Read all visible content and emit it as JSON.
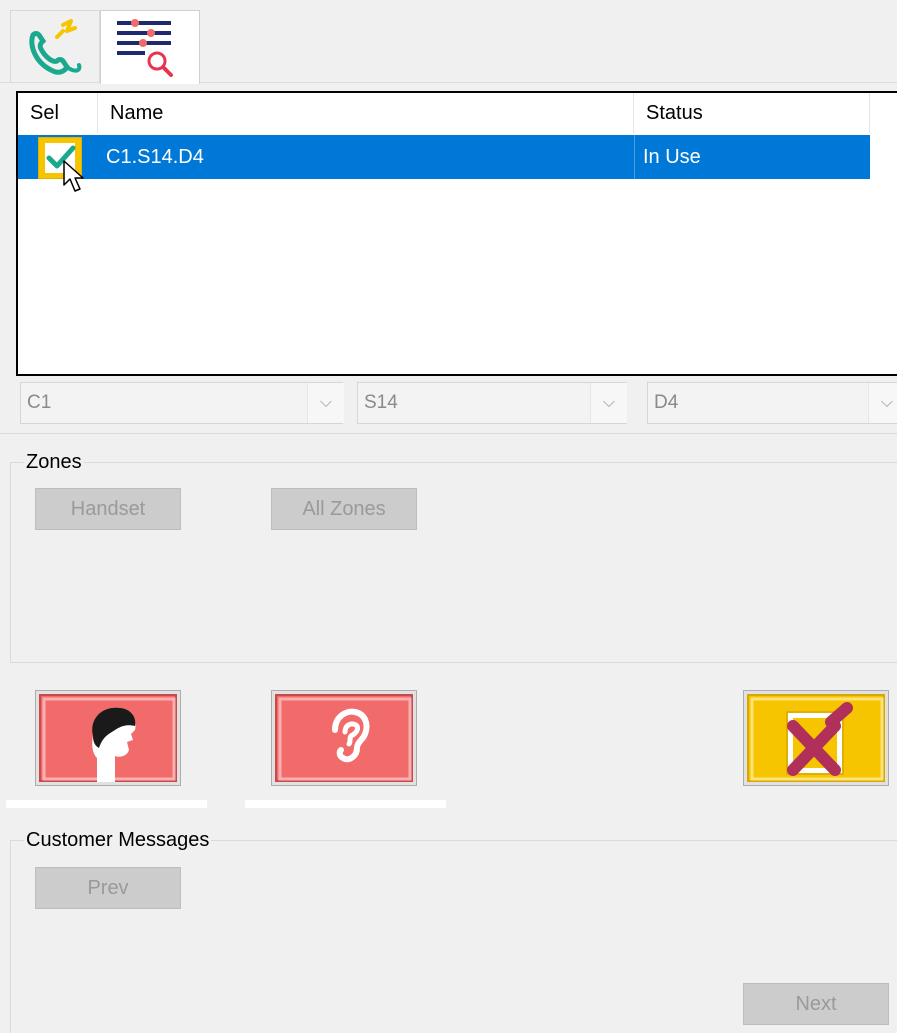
{
  "tabs": [
    {
      "icon": "phone-call-icon"
    },
    {
      "icon": "list-search-icon"
    }
  ],
  "list": {
    "columns": [
      "Sel",
      "Name",
      "Status"
    ],
    "rows": [
      {
        "selected": true,
        "name": "C1.S14.D4",
        "status": "In Use"
      }
    ]
  },
  "combos": {
    "c1": "C1",
    "s14": "S14",
    "d4": "D4"
  },
  "zones": {
    "label": "Zones",
    "handset": "Handset",
    "all_zones": "All Zones"
  },
  "actions": {
    "talk_icon": "person-speaking-icon",
    "listen_icon": "ear-icon",
    "cancel_icon": "checkbox-x-icon"
  },
  "messages": {
    "label": "Customer Messages",
    "prev": "Prev",
    "next": "Next"
  },
  "colors": {
    "selection": "#0078d7",
    "action_red": "#f26b6b",
    "action_yellow": "#f7c400",
    "tab_icon_green": "#1aa88f"
  }
}
